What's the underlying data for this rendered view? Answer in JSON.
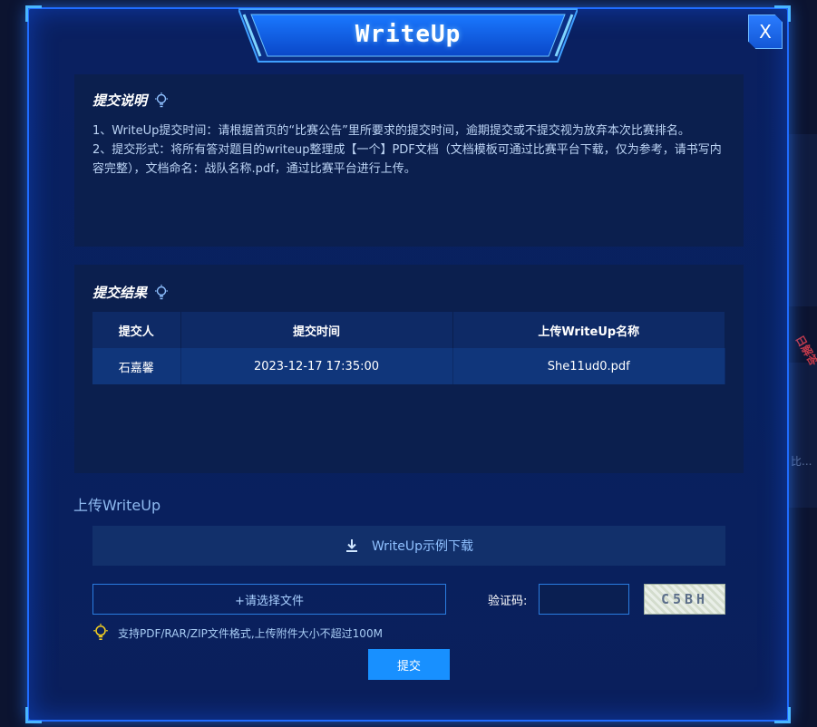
{
  "dialog": {
    "title": "WriteUp",
    "close_label": "X"
  },
  "instructions": {
    "title": "提交说明",
    "line1": "1、WriteUp提交时间：请根据首页的“比赛公告”里所要求的提交时间，逾期提交或不提交视为放弃本次比赛排名。",
    "line2": "2、提交形式：将所有答对题目的writeup整理成【一个】PDF文档（文档模板可通过比赛平台下载，仅为参考，请书写内容完整），文档命名：战队名称.pdf，通过比赛平台进行上传。"
  },
  "results": {
    "title": "提交结果",
    "columns": [
      "提交人",
      "提交时间",
      "上传WriteUp名称"
    ],
    "rows": [
      [
        "石嘉馨",
        "2023-12-17 17:35:00",
        "She11ud0.pdf"
      ]
    ]
  },
  "upload": {
    "section_title": "上传WriteUp",
    "download_label": "WriteUp示例下载",
    "choose_file_label": "+请选择文件",
    "captcha_label": "验证码:",
    "captcha_value": "",
    "captcha_text": "C5BH",
    "hint": "支持PDF/RAR/ZIP文件格式,上传附件大小不超过100M",
    "submit_label": "提交"
  },
  "background": {
    "side_text_1": "日解答",
    "side_text_2": "比..."
  },
  "colors": {
    "accent": "#1890ff",
    "border": "#1f6cff",
    "panel": "#0b1f4e"
  }
}
